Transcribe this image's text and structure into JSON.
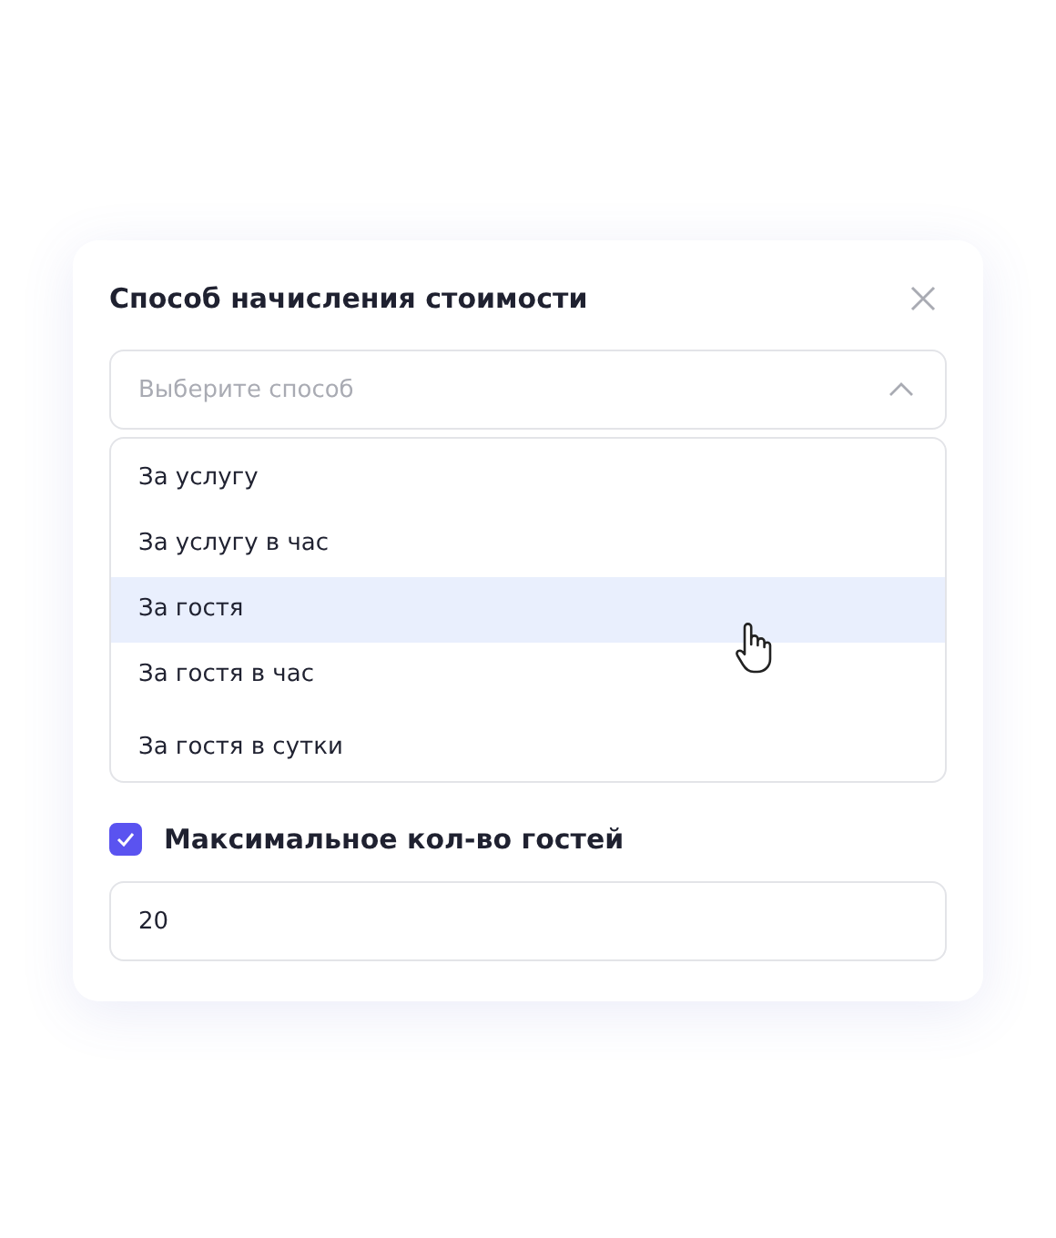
{
  "dialog": {
    "title": "Способ начисления стоимости"
  },
  "select": {
    "placeholder": "Выберите способ",
    "expanded": true
  },
  "options": [
    {
      "label": "За услугу",
      "selected": false
    },
    {
      "label": "За услугу в час",
      "selected": false
    },
    {
      "label": "За гостя",
      "selected": true
    },
    {
      "label": "За гостя в час",
      "selected": false
    },
    {
      "label": "За гостя в сутки",
      "selected": false
    }
  ],
  "max_guests": {
    "label": "Максимальное кол-во гостей",
    "checked": true,
    "value": "20"
  }
}
